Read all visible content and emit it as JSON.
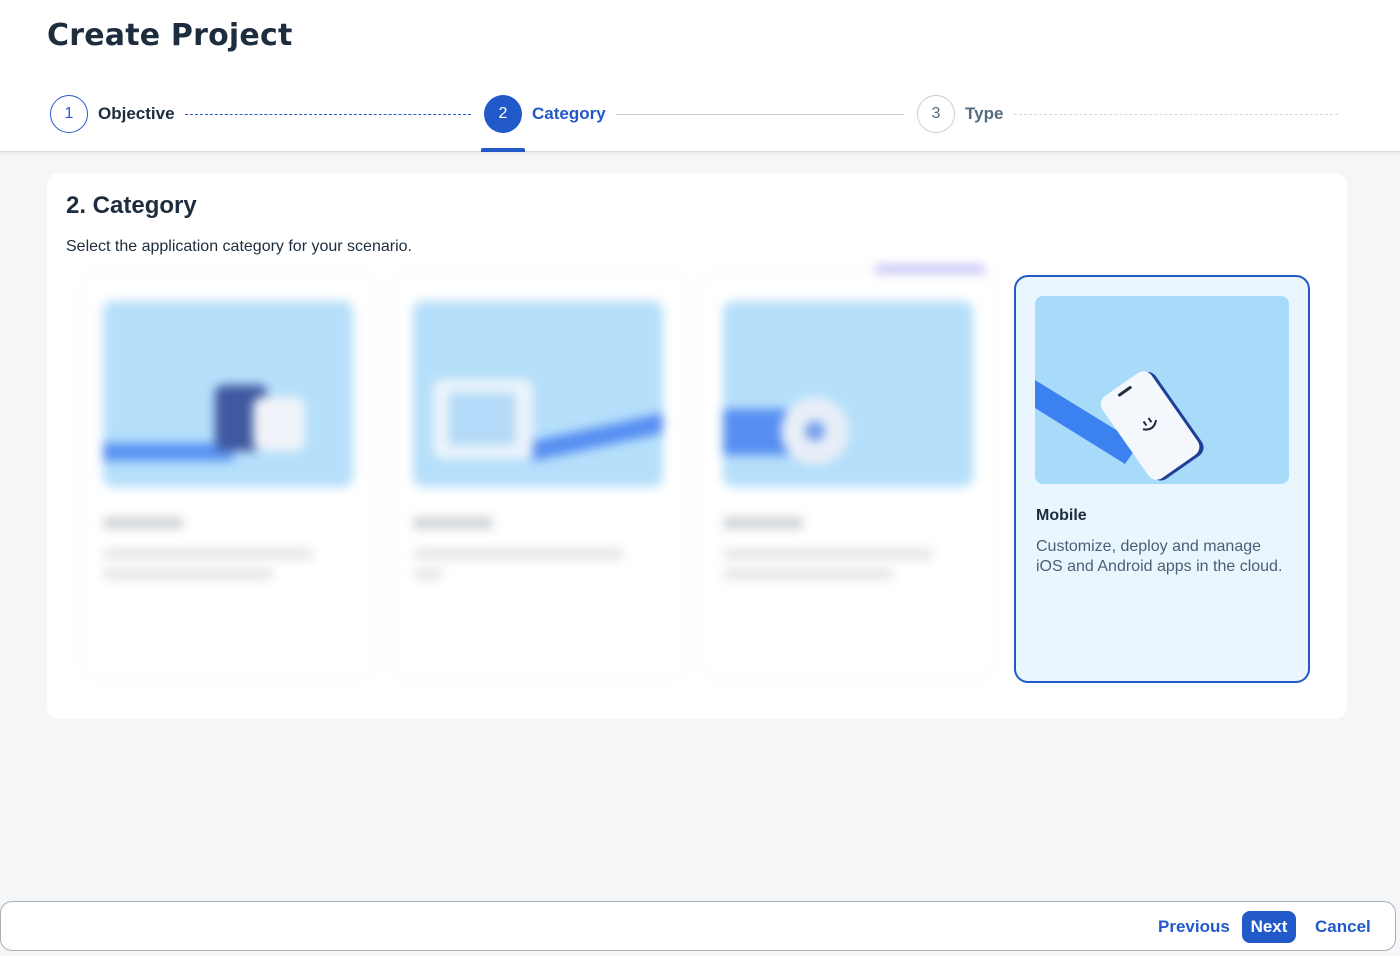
{
  "page": {
    "title": "Create Project"
  },
  "wizard": {
    "steps": [
      {
        "number": "1",
        "label": "Objective",
        "state": "completed"
      },
      {
        "number": "2",
        "label": "Category",
        "state": "active"
      },
      {
        "number": "3",
        "label": "Type",
        "state": "upcoming"
      }
    ]
  },
  "section": {
    "title": "2. Category",
    "description": "Select the application category for your scenario."
  },
  "cards": {
    "selected": {
      "title": "Mobile",
      "description": "Customize, deploy and manage iOS and Android apps in the cloud."
    }
  },
  "footer": {
    "previous_label": "Previous",
    "next_label": "Next",
    "cancel_label": "Cancel"
  },
  "colors": {
    "accent": "#2259c9",
    "card_selected_bg": "#eaf6fe",
    "illustration_bg": "#a8daf9"
  }
}
